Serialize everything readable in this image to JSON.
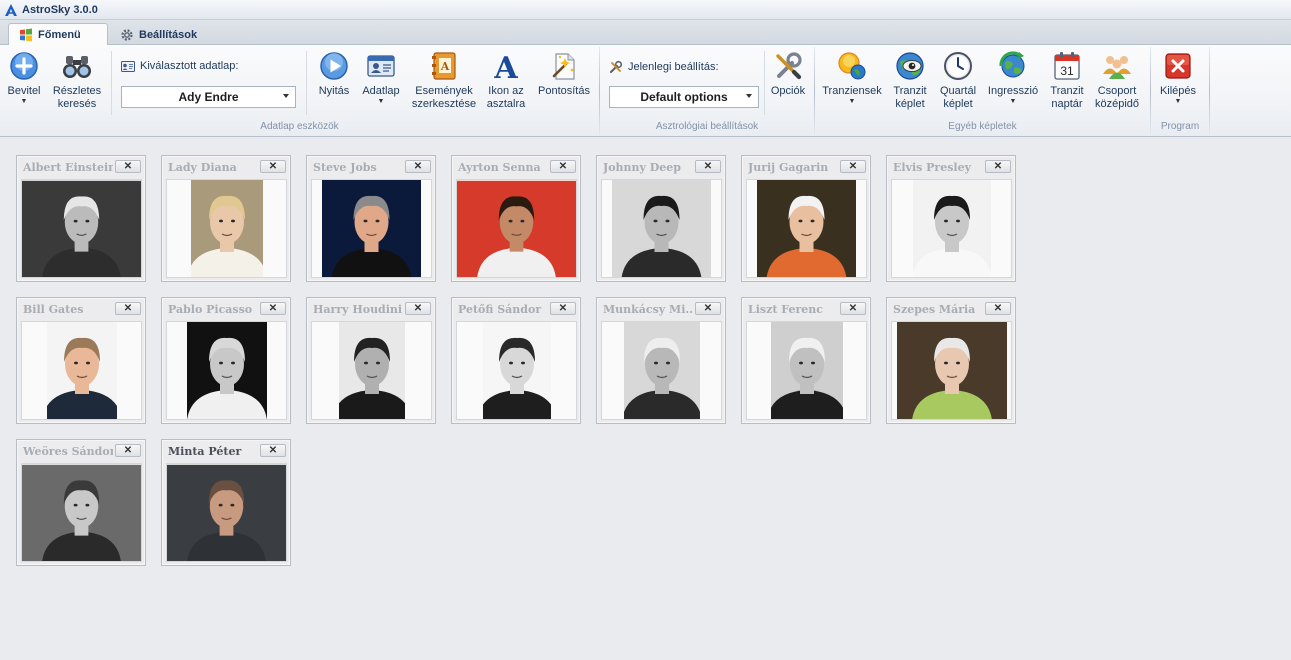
{
  "window": {
    "title": "AstroSky 3.0.0"
  },
  "tabs": [
    {
      "label": "Főmenü",
      "active": true
    },
    {
      "label": "Beállítások",
      "active": false
    }
  ],
  "ribbon": {
    "adatlap_group": {
      "label": "Adatlap eszközök",
      "bevitel": "Bevitel",
      "reszletes": [
        "Részletes",
        "keresés"
      ],
      "selected_label": "Kiválasztott adatlap:",
      "selected_value": "Ady Endre",
      "nyitas": "Nyitás",
      "adatlap": "Adatlap",
      "esemenyek": [
        "Események",
        "szerkesztése"
      ],
      "ikon": [
        "Ikon az",
        "asztalra"
      ],
      "pontositas": "Pontosítás"
    },
    "asztro_group": {
      "label": "Asztrológiai beállítások",
      "current_label": "Jelenlegi beállítás:",
      "current_value": "Default options",
      "opciok": "Opciók"
    },
    "egyeb_group": {
      "label": "Egyéb képletek",
      "tranziensek": "Tranziensek",
      "tranzit_keplet": [
        "Tranzit",
        "képlet"
      ],
      "quartal": [
        "Quartál",
        "képlet"
      ],
      "ingresszio": "Ingresszió",
      "tranzit_naptar": [
        "Tranzit",
        "naptár"
      ],
      "calendar_day": "31",
      "csoport": [
        "Csoport",
        "középidő"
      ]
    },
    "program_group": {
      "label": "Program",
      "kilepes": "Kilépés"
    }
  },
  "cards": [
    {
      "name": "Albert Einstein",
      "close": "✕",
      "active": false,
      "photo": {
        "w": 121,
        "bg": "#3a3a3a",
        "skin": "#c9b9a8",
        "hair": "#e6e6e6",
        "shirt": "#2d2d2d",
        "mono": true
      }
    },
    {
      "name": "Lady Diana",
      "close": "✕",
      "active": false,
      "photo": {
        "w": 72,
        "bg": "#a89a7a",
        "skin": "#e8c8a8",
        "hair": "#e0c890",
        "shirt": "#f4f1e8",
        "mono": false
      }
    },
    {
      "name": "Steve Jobs",
      "close": "✕",
      "active": false,
      "photo": {
        "w": 99,
        "bg": "#0b1a3a",
        "skin": "#e0a888",
        "hair": "#8a8a8a",
        "shirt": "#111111",
        "mono": false
      }
    },
    {
      "name": "Ayrton Senna",
      "close": "✕",
      "active": false,
      "photo": {
        "w": 121,
        "bg": "#d63a2a",
        "skin": "#c48a68",
        "hair": "#2a1a10",
        "shirt": "#f0f0f0",
        "mono": false
      }
    },
    {
      "name": "Johnny Deep",
      "close": "✕",
      "active": false,
      "photo": {
        "w": 99,
        "bg": "#d8d8d8",
        "skin": "#b8b8b8",
        "hair": "#1a1a1a",
        "shirt": "#2a2a2a",
        "mono": true
      }
    },
    {
      "name": "Jurij Gagarin",
      "close": "✕",
      "active": false,
      "photo": {
        "w": 99,
        "bg": "#3a3020",
        "skin": "#e8c0a0",
        "hair": "#f2f2f2",
        "shirt": "#e06a30",
        "mono": false
      }
    },
    {
      "name": "Elvis Presley",
      "close": "✕",
      "active": false,
      "photo": {
        "w": 78,
        "bg": "#f2f2f2",
        "skin": "#c8c8c8",
        "hair": "#1a1a1a",
        "shirt": "#f8f8f8",
        "mono": true
      }
    },
    {
      "name": "Bill Gates",
      "close": "✕",
      "active": false,
      "photo": {
        "w": 70,
        "bg": "#f4f4f4",
        "skin": "#e8b898",
        "hair": "#9a7a58",
        "shirt": "#1e2a3a",
        "mono": false
      }
    },
    {
      "name": "Pablo Picasso",
      "close": "✕",
      "active": false,
      "photo": {
        "w": 80,
        "bg": "#111111",
        "skin": "#c8c8c8",
        "hair": "#d8d8d8",
        "shirt": "#f0f0f0",
        "mono": true
      }
    },
    {
      "name": "Harry Houdini",
      "close": "✕",
      "active": false,
      "photo": {
        "w": 66,
        "bg": "#e8e8e8",
        "skin": "#b0b0b0",
        "hair": "#222222",
        "shirt": "#1a1a1a",
        "mono": true
      }
    },
    {
      "name": "Petőfi Sándor",
      "close": "✕",
      "active": false,
      "photo": {
        "w": 68,
        "bg": "#f6f6f6",
        "skin": "#d8d8d8",
        "hair": "#2a2a2a",
        "shirt": "#1e1e1e",
        "mono": true
      }
    },
    {
      "name": "Munkácsy Mi...",
      "close": "✕",
      "active": false,
      "photo": {
        "w": 76,
        "bg": "#d8d8d8",
        "skin": "#b8b8b8",
        "hair": "#eeeeee",
        "shirt": "#2a2a2a",
        "mono": true
      }
    },
    {
      "name": "Liszt Ferenc",
      "close": "✕",
      "active": false,
      "photo": {
        "w": 72,
        "bg": "#cfcfcf",
        "skin": "#c0c0c0",
        "hair": "#f0f0f0",
        "shirt": "#1e1e1e",
        "mono": true
      }
    },
    {
      "name": "Szepes Mária",
      "close": "✕",
      "active": false,
      "photo": {
        "w": 110,
        "bg": "#4a3a2a",
        "skin": "#e8c8b0",
        "hair": "#e8e8e8",
        "shirt": "#a8c860",
        "mono": false
      }
    },
    {
      "name": "Weöres Sándor",
      "close": "✕",
      "active": false,
      "photo": {
        "w": 121,
        "bg": "#6a6a6a",
        "skin": "#c8c8c8",
        "hair": "#3a3a3a",
        "shirt": "#2a2a2a",
        "mono": true
      }
    },
    {
      "name": "Minta Péter",
      "close": "✕",
      "active": true,
      "photo": {
        "w": 121,
        "bg": "#3a3e42",
        "skin": "#c89a80",
        "hair": "#6a5040",
        "shirt": "#2e3236",
        "mono": false
      }
    }
  ]
}
